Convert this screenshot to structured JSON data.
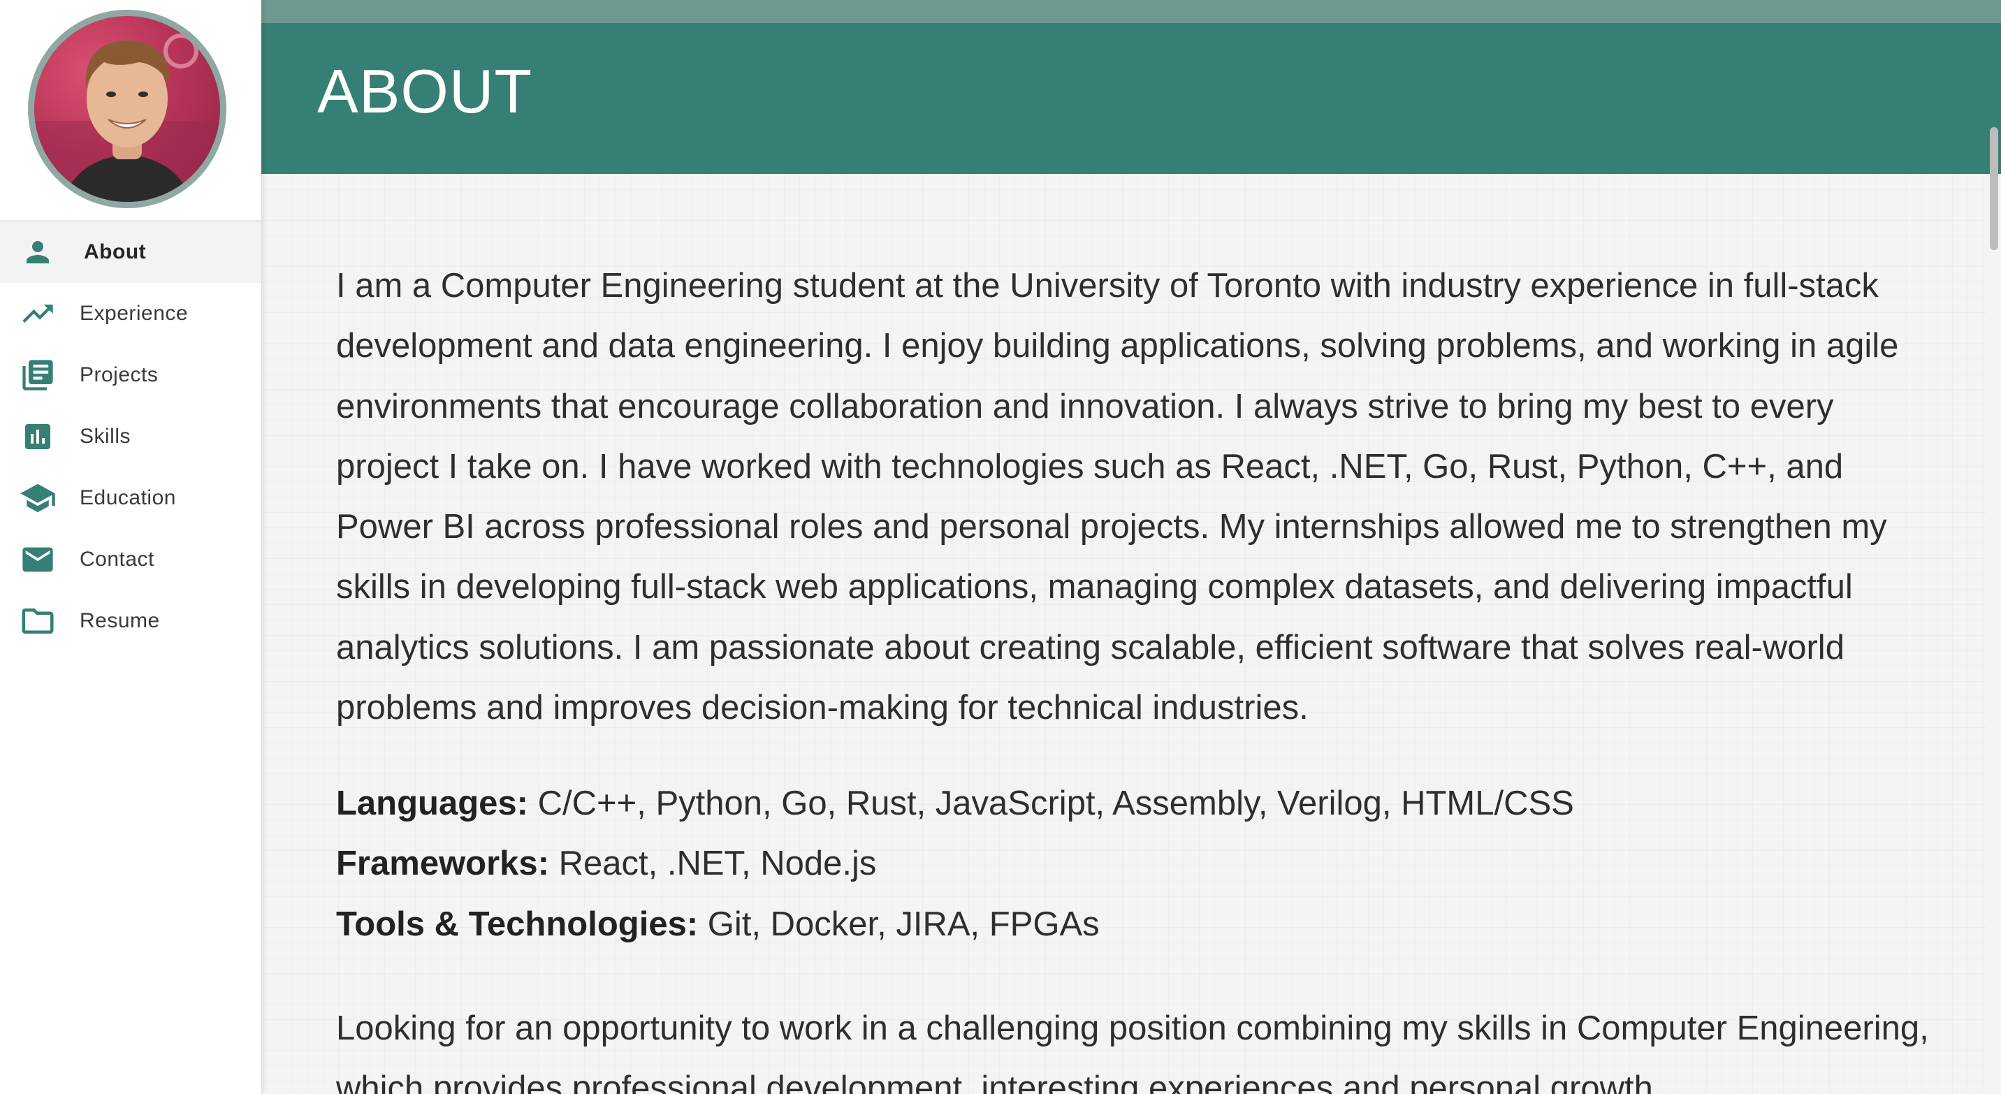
{
  "sidebar": {
    "avatar_icon": "profile-photo",
    "items": [
      {
        "label": "About",
        "icon": "person-icon",
        "active": true
      },
      {
        "label": "Experience",
        "icon": "trending-up-icon",
        "active": false
      },
      {
        "label": "Projects",
        "icon": "library-books-icon",
        "active": false
      },
      {
        "label": "Skills",
        "icon": "bar-chart-icon",
        "active": false
      },
      {
        "label": "Education",
        "icon": "graduation-cap-icon",
        "active": false
      },
      {
        "label": "Contact",
        "icon": "mail-icon",
        "active": false
      },
      {
        "label": "Resume",
        "icon": "folder-icon",
        "active": false
      }
    ]
  },
  "header": {
    "title": "ABOUT"
  },
  "main": {
    "intro": "I am a Computer Engineering student at the University of Toronto with industry experience in full-stack development and data engineering. I enjoy building applications, solving problems, and working in agile environments that encourage collaboration and innovation. I always strive to bring my best to every project I take on. I have worked with technologies such as React, .NET, Go, Rust, Python, C++, and Power BI across professional roles and personal projects. My internships allowed me to strengthen my skills in developing full-stack web applications, managing complex datasets, and delivering impactful analytics solutions. I am passionate about creating scalable, efficient software that solves real-world problems and improves decision-making for technical industries.",
    "skills": [
      {
        "key": "Languages:",
        "value": "C/C++, Python, Go, Rust, JavaScript, Assembly, Verilog, HTML/CSS"
      },
      {
        "key": "Frameworks:",
        "value": "React, .NET, Node.js"
      },
      {
        "key": "Tools & Technologies:",
        "value": "Git, Docker, JIRA, FPGAs"
      }
    ],
    "closing": "Looking for an opportunity to work in a challenging position combining my skills in Computer Engineering, which provides professional development, interesting experiences and personal growth."
  },
  "colors": {
    "accent": "#367f74",
    "top_strip": "#6f9890",
    "icon": "#367f74",
    "avatar_ring": "#8fa8a3"
  }
}
